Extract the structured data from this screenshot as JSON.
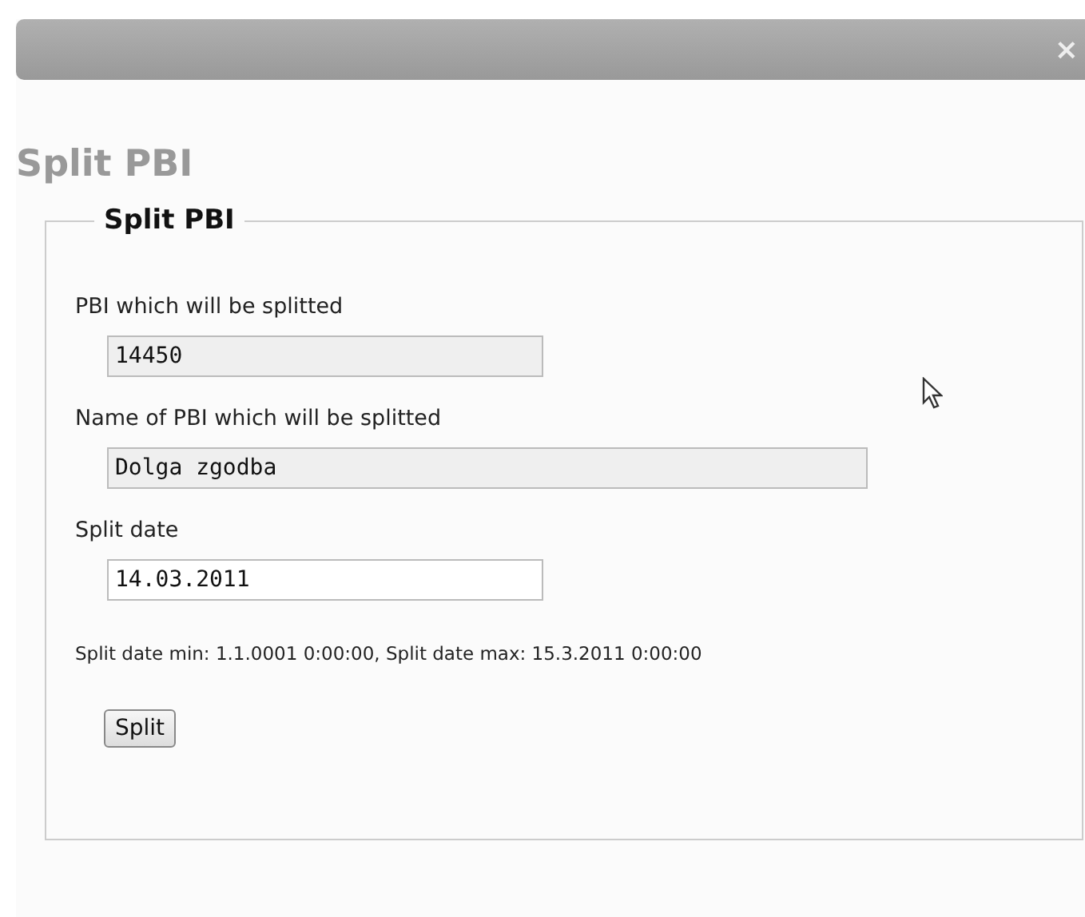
{
  "dialog": {
    "close_button": "×",
    "heading": "Split PBI"
  },
  "form": {
    "legend": "Split PBI",
    "fields": [
      {
        "label": "PBI which will be splitted",
        "value": "14450",
        "readonly": true
      },
      {
        "label": "Name of PBI which will be splitted",
        "value": "Dolga zgodba",
        "readonly": true
      },
      {
        "label": "Split date",
        "value": "14.03.2011",
        "readonly": false
      }
    ],
    "note": "Split date min: 1.1.0001 0:00:00, Split date max: 15.3.2011 0:00:00",
    "button": "Split"
  }
}
